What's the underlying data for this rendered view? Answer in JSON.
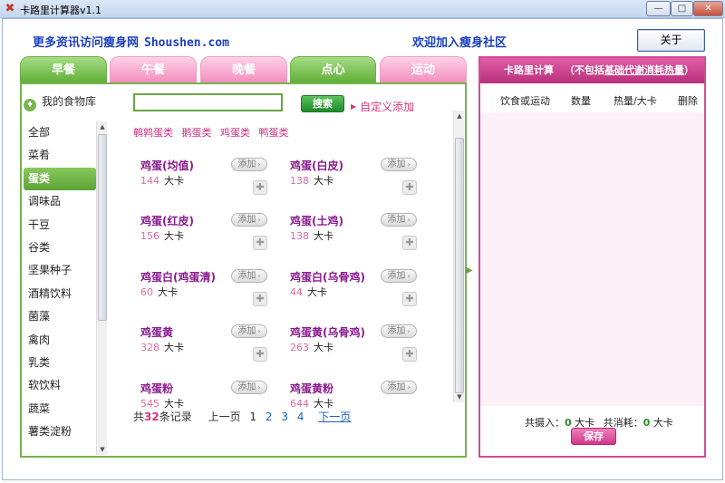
{
  "window": {
    "title": "卡路里计算器v1.1",
    "buttons": {
      "minimize": "—",
      "maximize": "□",
      "close": "✕"
    }
  },
  "header": {
    "promo_left_cn": "更多资讯访问瘦身网",
    "promo_left_en": "Shoushen.com",
    "promo_mid": "欢迎加入瘦身社区",
    "about_label": "关于"
  },
  "tabs": [
    {
      "label": "早餐",
      "style": "green"
    },
    {
      "label": "午餐",
      "style": "pink"
    },
    {
      "label": "晚餐",
      "style": "pink"
    },
    {
      "label": "点心",
      "style": "green"
    },
    {
      "label": "运动",
      "style": "pink"
    }
  ],
  "library": {
    "title": "我的食物库",
    "search_value": "",
    "search_button": "搜索",
    "custom_add": "自定义添加"
  },
  "categories": [
    "全部",
    "菜肴",
    "蛋类",
    "调味品",
    "干豆",
    "谷类",
    "坚果种子",
    "酒精饮料",
    "菌藻",
    "禽肉",
    "乳类",
    "软饮料",
    "蔬菜",
    "薯类淀粉"
  ],
  "active_category_index": 2,
  "subcategories": [
    "鹌鹑蛋类",
    "鹅蛋类",
    "鸡蛋类",
    "鸭蛋类"
  ],
  "foods": [
    {
      "name": "鸡蛋(均值)",
      "cal": "144",
      "unit": "大卡"
    },
    {
      "name": "鸡蛋(白皮)",
      "cal": "138",
      "unit": "大卡"
    },
    {
      "name": "鸡蛋(红皮)",
      "cal": "156",
      "unit": "大卡"
    },
    {
      "name": "鸡蛋(土鸡)",
      "cal": "138",
      "unit": "大卡"
    },
    {
      "name": "鸡蛋白(鸡蛋清)",
      "cal": "60",
      "unit": "大卡"
    },
    {
      "name": "鸡蛋白(乌骨鸡)",
      "cal": "44",
      "unit": "大卡"
    },
    {
      "name": "鸡蛋黄",
      "cal": "328",
      "unit": "大卡"
    },
    {
      "name": "鸡蛋黄(乌骨鸡)",
      "cal": "263",
      "unit": "大卡"
    },
    {
      "name": "鸡蛋粉",
      "cal": "545",
      "unit": "大卡"
    },
    {
      "name": "鸡蛋黄粉",
      "cal": "644",
      "unit": "大卡"
    }
  ],
  "food_add_label": "添加",
  "pager": {
    "prefix": "共",
    "count": "32",
    "suffix": "条记录",
    "prev": "上一页",
    "pages": [
      "1",
      "2",
      "3",
      "4"
    ],
    "current_page": "1",
    "next": "下一页"
  },
  "calc": {
    "title": "卡路里计算",
    "note_prefix": "（不包括",
    "note_link": "基础代谢消耗热量",
    "note_suffix": "）",
    "columns": [
      "饮食或运动",
      "数量",
      "热量/大卡",
      "删除"
    ],
    "intake_label": "共摄入：",
    "intake_value": "0",
    "burn_label": "共消耗：",
    "burn_value": "0",
    "unit": "大卡",
    "save_label": "保存"
  },
  "colors": {
    "green": "#5fae37",
    "pink": "#d04e94",
    "link_blue": "#1a3fbf",
    "food_name": "#8a1a8e",
    "calorie": "#e0689f"
  }
}
